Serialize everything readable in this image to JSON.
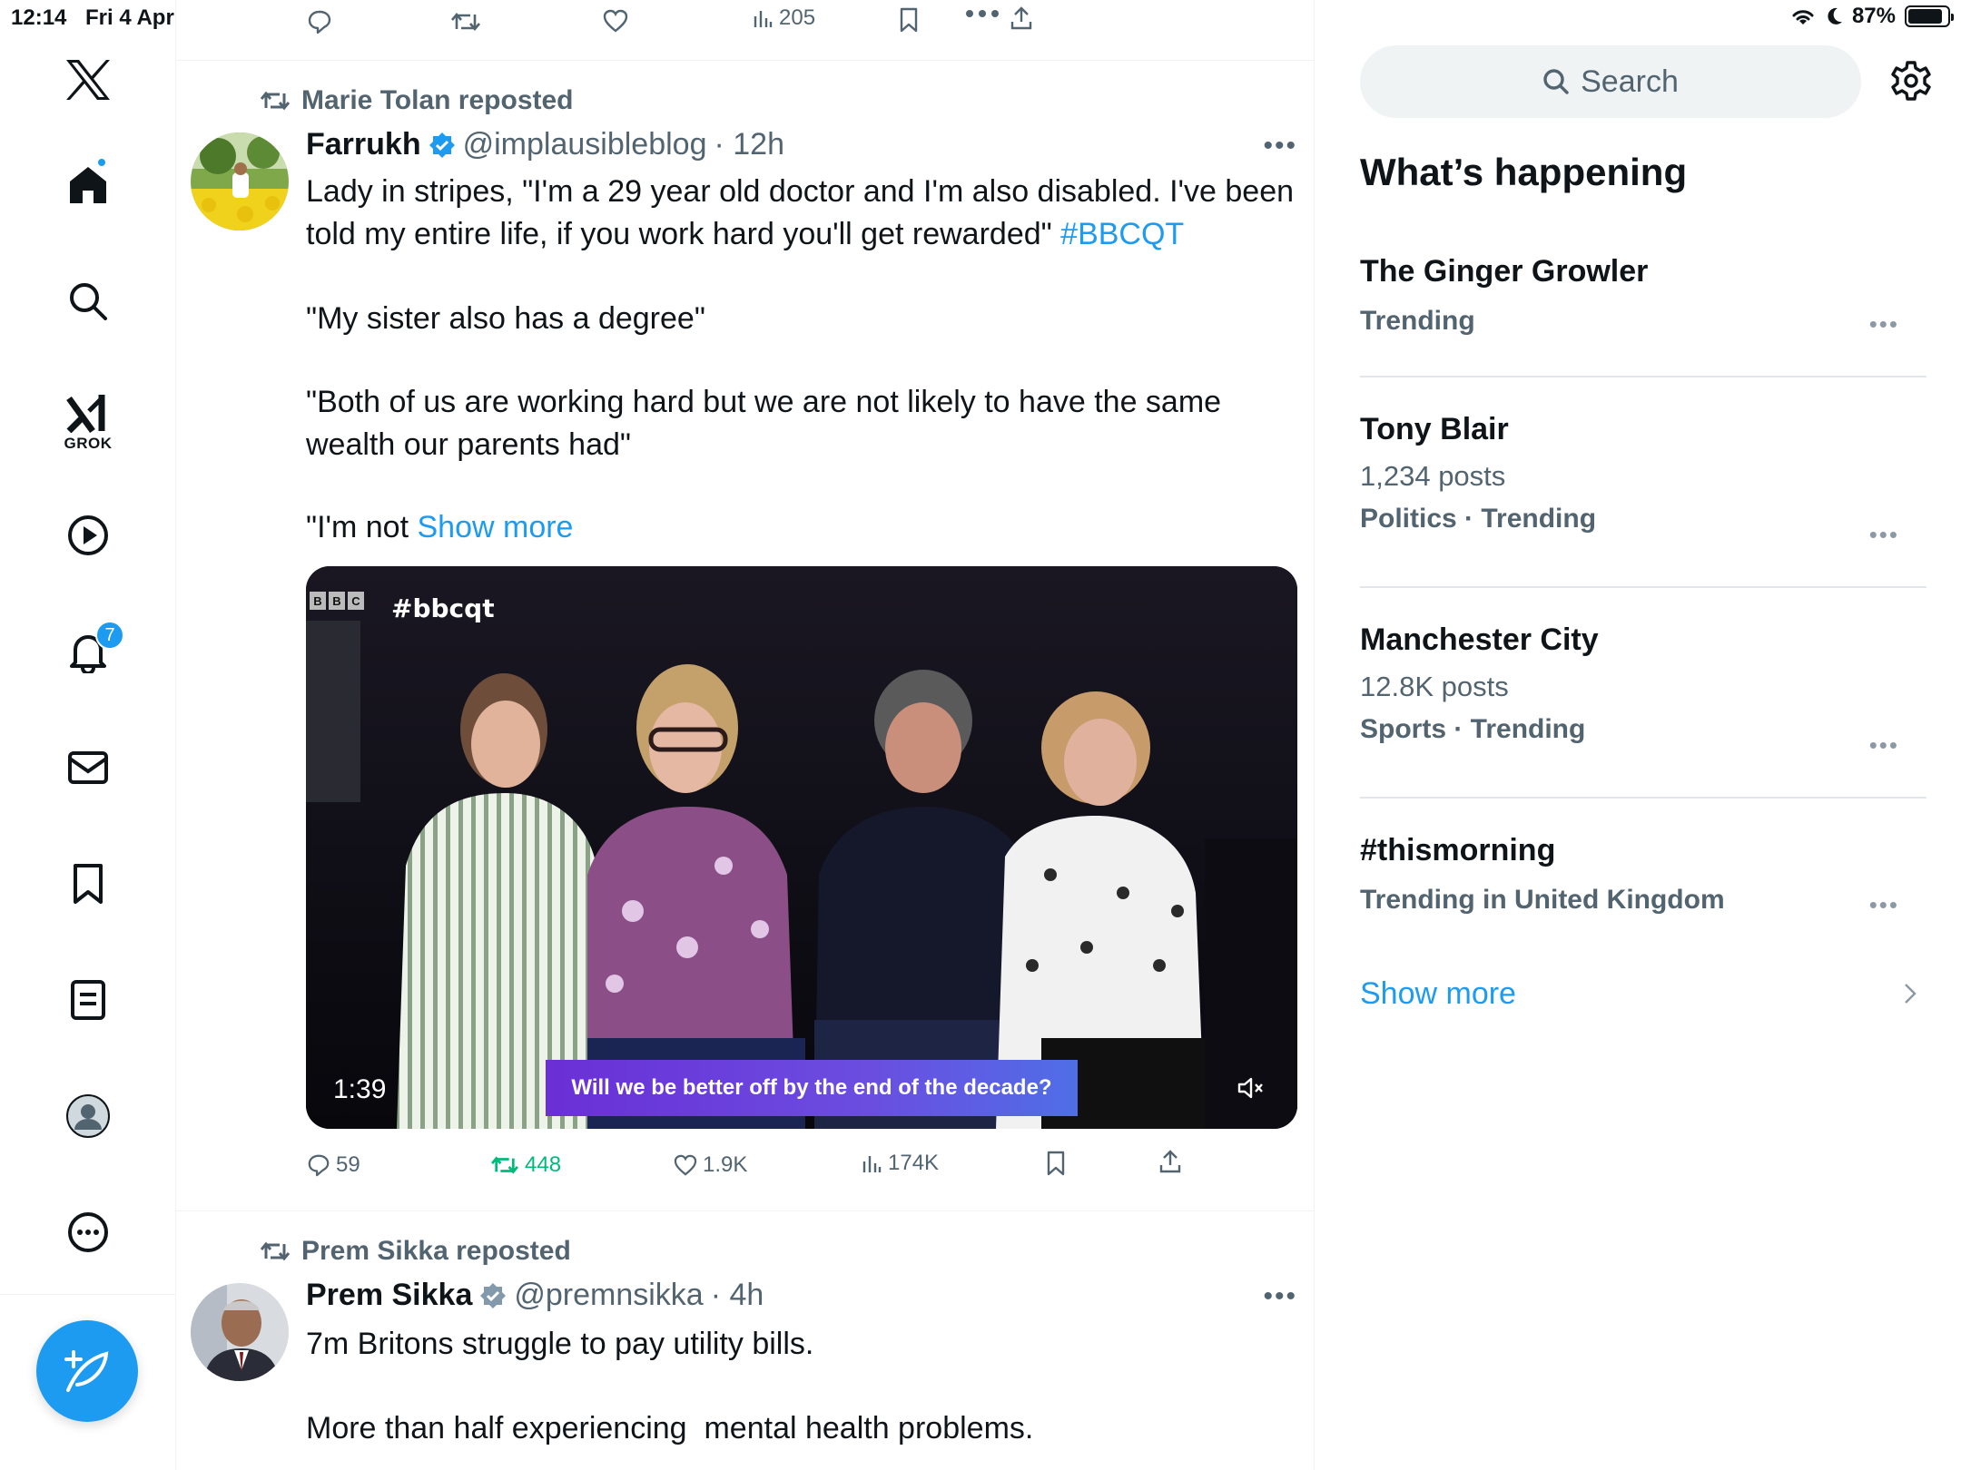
{
  "status_bar": {
    "time": "12:14",
    "date": "Fri 4 Apr",
    "battery": "87%",
    "battery_level": 0.87
  },
  "nav": {
    "grok_label": "GROK",
    "notifications_count": "7",
    "accent_color": "#1d9bf0"
  },
  "prev_tweet_actions": {
    "views": "205"
  },
  "tweets": [
    {
      "repost_by": "Marie Tolan reposted",
      "name": "Farrukh",
      "handle": "@implausibleblog",
      "time": "· 12h",
      "text_p1": "Lady in stripes, \"I'm a 29 year old doctor and I'm also disabled. I've been told my entire life, if you work hard you'll get rewarded\" ",
      "hashtag": "#BBCQT",
      "text_p2": "\"My sister also has a degree\"",
      "text_p3": "\"Both of us are working hard but we are not likely to have the same wealth our parents had\"",
      "text_p4": "\"I'm not ",
      "show_more": "Show more",
      "video": {
        "tag": "#bbcqt",
        "duration": "1:39",
        "caption": "Will we be better off by the end of the decade?",
        "bbc_letters": [
          "B",
          "B",
          "C"
        ]
      },
      "replies": "59",
      "reposts": "448",
      "likes": "1.9K",
      "views": "174K"
    },
    {
      "repost_by": "Prem Sikka reposted",
      "name": "Prem Sikka",
      "handle": "@premnsikka",
      "time": "· 4h",
      "text_p1": "7m Britons struggle to pay utility bills.",
      "text_p2": "More than half experiencing  mental health problems."
    }
  ],
  "right": {
    "search_placeholder": "Search",
    "whats_happening": "What’s happening",
    "trends": [
      {
        "name": "The Ginger Growler",
        "posts": "",
        "meta": "Trending"
      },
      {
        "name": "Tony Blair",
        "posts": "1,234 posts",
        "meta": "Politics · Trending"
      },
      {
        "name": "Manchester City",
        "posts": "12.8K posts",
        "meta": "Sports · Trending"
      },
      {
        "name": "#thismorning",
        "posts": "",
        "meta": "Trending in United Kingdom"
      }
    ],
    "show_more": "Show more"
  }
}
